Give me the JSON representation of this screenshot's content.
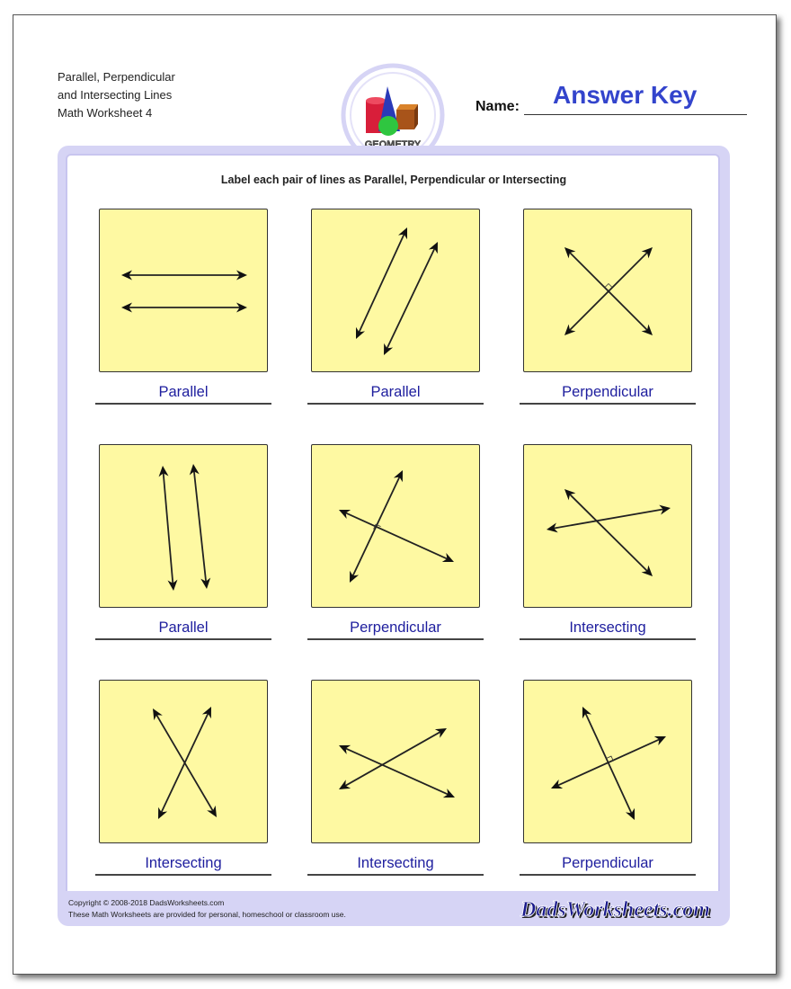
{
  "header": {
    "title_lines": [
      "Parallel, Perpendicular",
      "and Intersecting Lines",
      "Math Worksheet 4"
    ],
    "logo_text": "GEOMETRY",
    "name_label": "Name:",
    "name_value": "Answer Key"
  },
  "instructions": "Label each pair of lines as Parallel, Perpendicular or Intersecting",
  "problems": [
    {
      "answer": "Parallel"
    },
    {
      "answer": "Parallel"
    },
    {
      "answer": "Perpendicular"
    },
    {
      "answer": "Parallel"
    },
    {
      "answer": "Perpendicular"
    },
    {
      "answer": "Intersecting"
    },
    {
      "answer": "Intersecting"
    },
    {
      "answer": "Intersecting"
    },
    {
      "answer": "Perpendicular"
    }
  ],
  "footer": {
    "copyright": "Copyright © 2008-2018 DadsWorksheets.com",
    "usage": "These Math Worksheets are provided for personal, homeschool or classroom use.",
    "brand": "DadsWorksheets.com"
  },
  "colors": {
    "answer_text": "#1e1e9e",
    "name_value": "#3344cc",
    "panel_fill": "#fef9a2",
    "frame": "#d6d4f5"
  }
}
